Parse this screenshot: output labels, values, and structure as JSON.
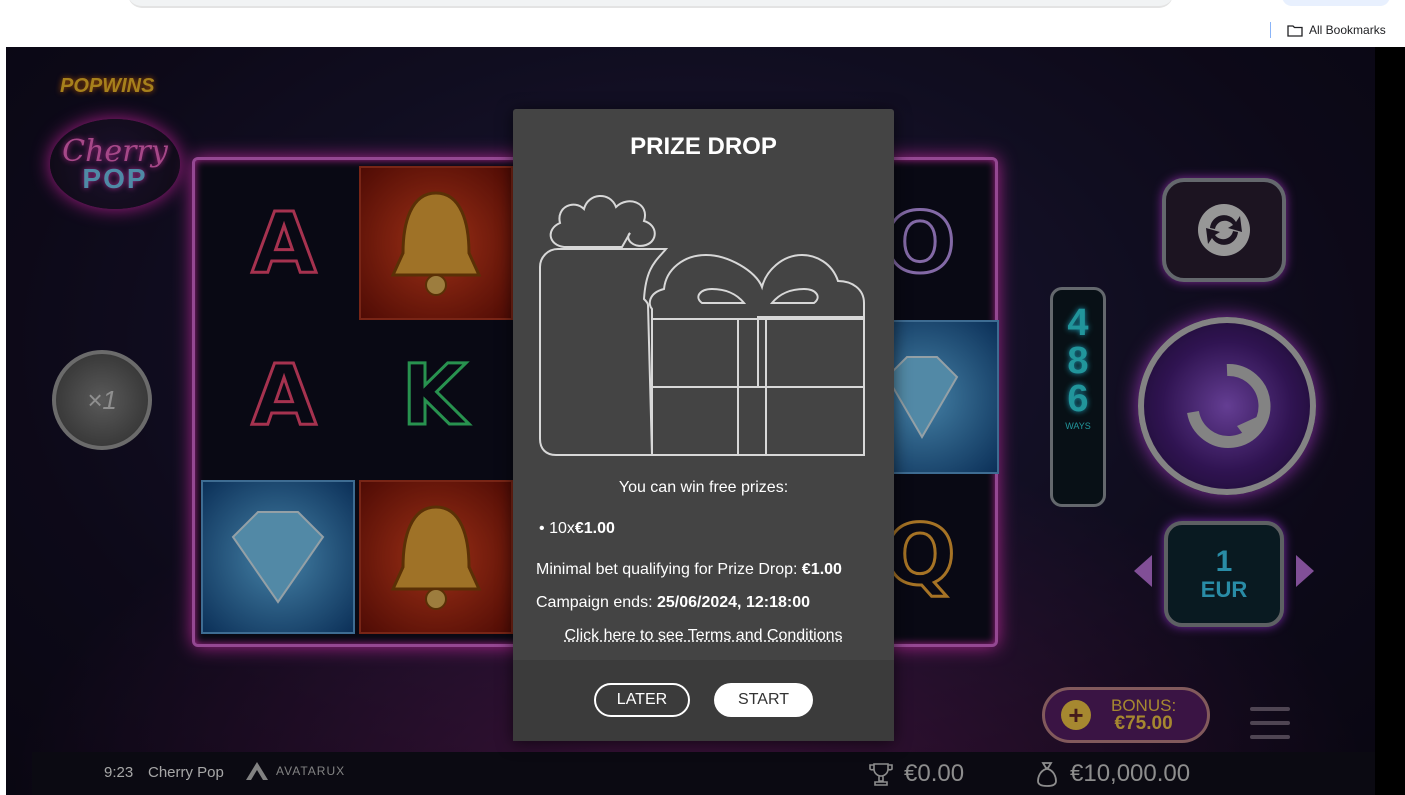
{
  "browser": {
    "bookmarks_label": "All Bookmarks"
  },
  "game": {
    "brand_logo": "POPWINS",
    "game_logo_line1": "Cherry",
    "game_logo_line2": "POP",
    "multiplier": "×1",
    "ways": {
      "digits": [
        "4",
        "8",
        "6"
      ],
      "label": "WAYS"
    },
    "reels": [
      [
        "A",
        "bell",
        "",
        "",
        "O"
      ],
      [
        "A",
        "K",
        "",
        "",
        "diamond"
      ],
      [
        "diamond",
        "bell",
        "",
        "",
        "Q"
      ]
    ],
    "bet": {
      "value": "1",
      "currency": "EUR"
    },
    "bonus": {
      "label": "BONUS:",
      "amount": "€75.00"
    },
    "footer": {
      "time": "9:23",
      "game_name": "Cherry Pop",
      "provider": "AVATARUX",
      "win": "€0.00",
      "balance": "€10,000.00"
    },
    "icons": [
      "autoplay-icon",
      "spin-icon",
      "menu-icon",
      "trophy-icon",
      "money-bag-icon",
      "gift-icon"
    ],
    "colors": {
      "modal_bg": "#444444",
      "neon_pink": "#ff39d4",
      "neon_cyan": "#34e5ee",
      "bonus_gold": "#ffd14a"
    }
  },
  "modal": {
    "title": "PRIZE DROP",
    "intro": "You can win free prizes:",
    "prize_item": {
      "bullet": "•",
      "count": "10x",
      "amount": "€1.00"
    },
    "min_bet": {
      "label": "Minimal bet qualifying for Prize Drop:",
      "value": "€1.00"
    },
    "campaign": {
      "label": "Campaign ends:",
      "value": "25/06/2024, 12:18:00"
    },
    "terms_link": "Click here to see Terms and Conditions",
    "later_button": "LATER",
    "start_button": "START"
  }
}
